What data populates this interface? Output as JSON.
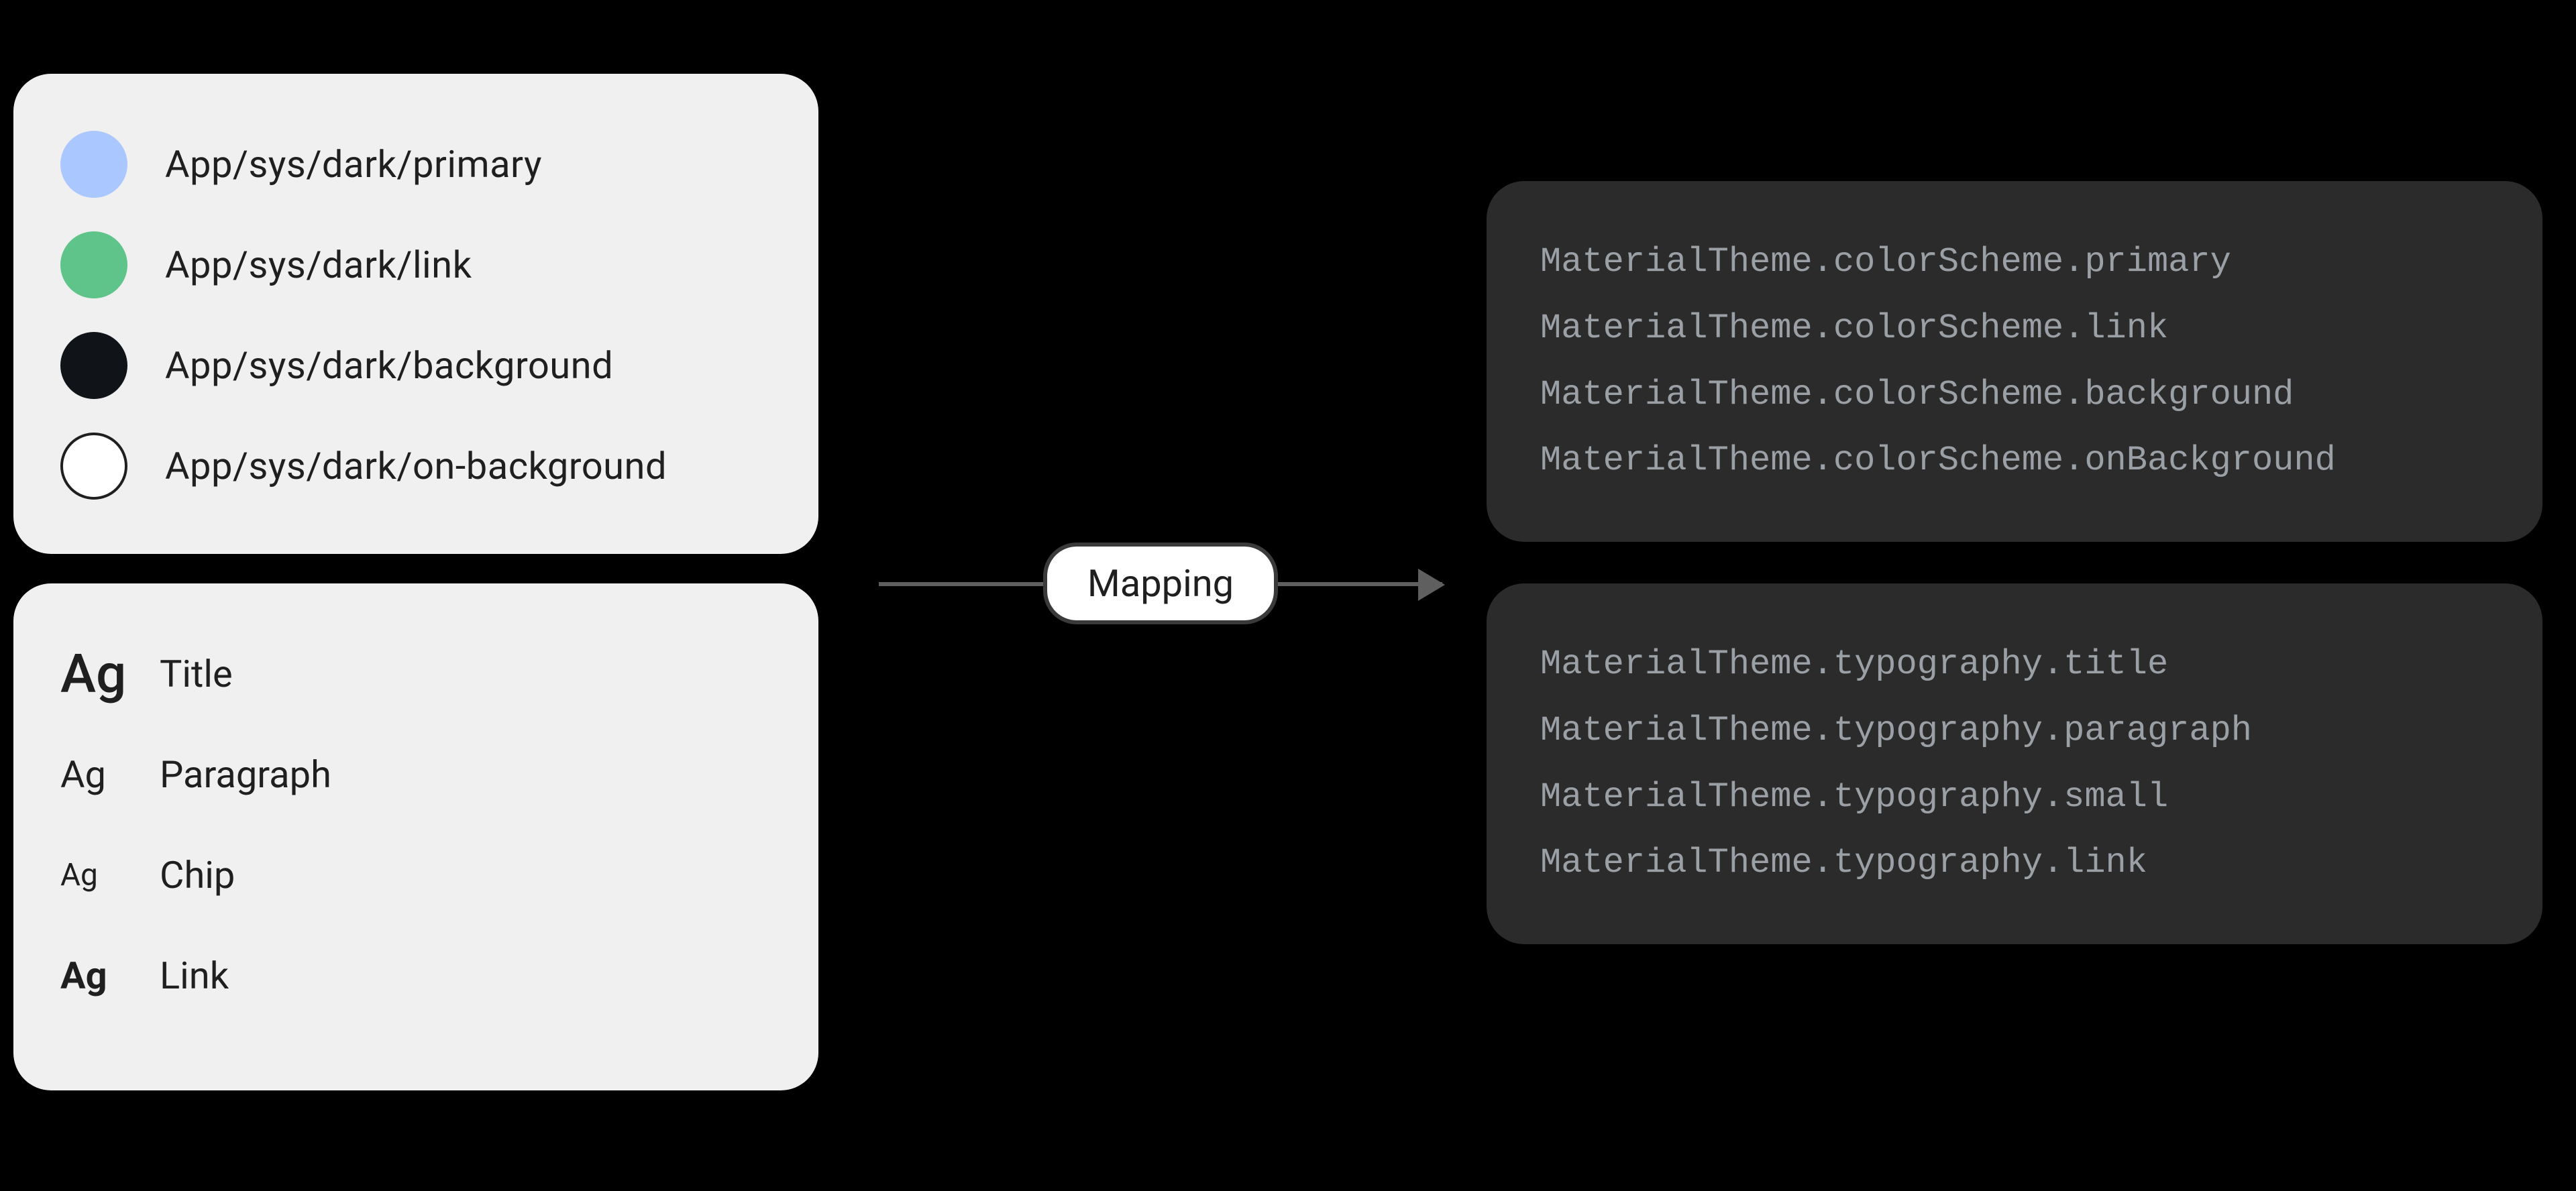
{
  "mapping_label": "Mapping",
  "colors": {
    "primary": {
      "hex": "#aac7ff",
      "label": "App/sys/dark/primary",
      "border": false
    },
    "link": {
      "hex": "#5fc48a",
      "label": "App/sys/dark/link",
      "border": false
    },
    "background": {
      "hex": "#101418",
      "label": "App/sys/dark/background",
      "border": false
    },
    "onBackground": {
      "hex": "#ffffff",
      "label": "App/sys/dark/on-background",
      "border": true
    }
  },
  "typography": {
    "sample_glyph": "Ag",
    "title": {
      "label": "Title"
    },
    "paragraph": {
      "label": "Paragraph"
    },
    "chip": {
      "label": "Chip"
    },
    "link": {
      "label": "Link"
    }
  },
  "code_colors": {
    "l0": "MaterialTheme.colorScheme.primary",
    "l1": "MaterialTheme.colorScheme.link",
    "l2": "MaterialTheme.colorScheme.background",
    "l3": "MaterialTheme.colorScheme.onBackground"
  },
  "code_typo": {
    "l0": "MaterialTheme.typography.title",
    "l1": "MaterialTheme.typography.paragraph",
    "l2": "MaterialTheme.typography.small",
    "l3": "MaterialTheme.typography.link"
  }
}
